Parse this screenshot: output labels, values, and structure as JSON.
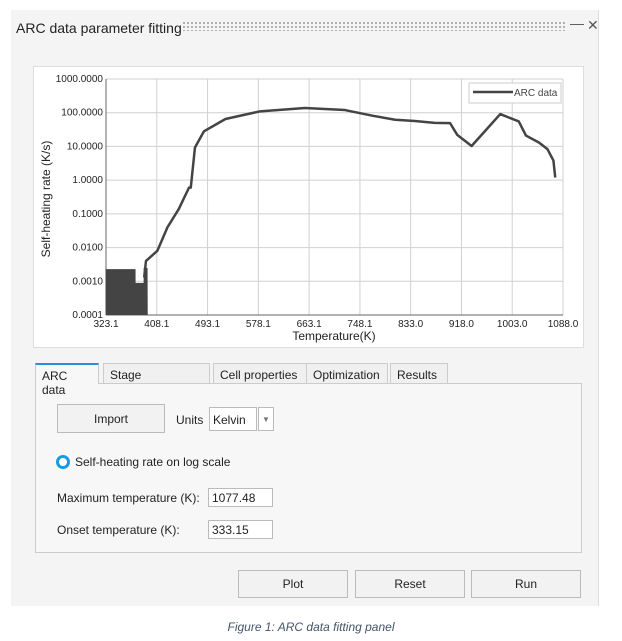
{
  "window": {
    "title": "ARC data parameter fitting",
    "minimize_icon": "minus-icon",
    "close_icon": "close-icon"
  },
  "chart_data": {
    "type": "line",
    "xlabel": "Temperature(K)",
    "ylabel": "Self-heating rate (K/s)",
    "xscale": "linear",
    "yscale": "log",
    "xlim": [
      323.1,
      1088.0
    ],
    "ylim": [
      0.0001,
      1000
    ],
    "xticks": [
      "323.1",
      "408.1",
      "493.1",
      "578.1",
      "663.1",
      "748.1",
      "833.0",
      "918.0",
      "1003.0",
      "1088.0"
    ],
    "xtick_values": [
      323.1,
      408.1,
      493.1,
      578.1,
      663.1,
      748.1,
      833.0,
      918.0,
      1003.0,
      1088.0
    ],
    "yticks": [
      "1000.0000",
      "100.0000",
      "10.0000",
      "1.0000",
      "0.1000",
      "0.0100",
      "0.0010",
      "0.0001"
    ],
    "ytick_values": [
      1000,
      100,
      10,
      1,
      0.1,
      0.01,
      0.001,
      0.0001
    ],
    "grid": true,
    "legend": {
      "position": "top-right",
      "entries": [
        "ARC data"
      ]
    },
    "series": [
      {
        "name": "ARC data",
        "color": "#444444",
        "noise": {
          "x_start": 323.1,
          "x_end": 390,
          "low": 0.0001,
          "high_segments": [
            [
              323.1,
              372,
              0.0023
            ],
            [
              372,
              387,
              0.0009
            ],
            [
              387,
              392,
              0.0025
            ]
          ]
        },
        "x": [
          387,
          390,
          409,
          426,
          445,
          462,
          465,
          472,
          487,
          523,
          581,
          656,
          723,
          770,
          807,
          840,
          873,
          899,
          911,
          935,
          983,
          1014,
          1026,
          1048,
          1062,
          1072,
          1075
        ],
        "y": [
          0.0013,
          0.004,
          0.008,
          0.04,
          0.14,
          0.6,
          0.6,
          9.3,
          28,
          65,
          110,
          138,
          120,
          81,
          62,
          57,
          50,
          49,
          22,
          10.3,
          91,
          55,
          21,
          13,
          8.3,
          3.8,
          1.2
        ]
      }
    ]
  },
  "tabs": [
    {
      "label": "ARC data",
      "active": true
    },
    {
      "label": "Stage information"
    },
    {
      "label": "Cell properties"
    },
    {
      "label": "Optimization"
    },
    {
      "label": "Results"
    }
  ],
  "arc": {
    "import_label": "Import",
    "units_label": "Units",
    "units_value": "Kelvin",
    "log_scale_label": "Self-heating rate on log scale",
    "max_temp_label": "Maximum temperature (K):",
    "max_temp_value": "1077.48",
    "onset_temp_label": "Onset temperature (K):",
    "onset_temp_value": "333.15"
  },
  "actions": {
    "plot": "Plot",
    "reset": "Reset",
    "run": "Run"
  },
  "caption": "Figure 1: ARC data fitting panel",
  "colors": {
    "accent": "#1a9be0",
    "line": "#444444"
  }
}
